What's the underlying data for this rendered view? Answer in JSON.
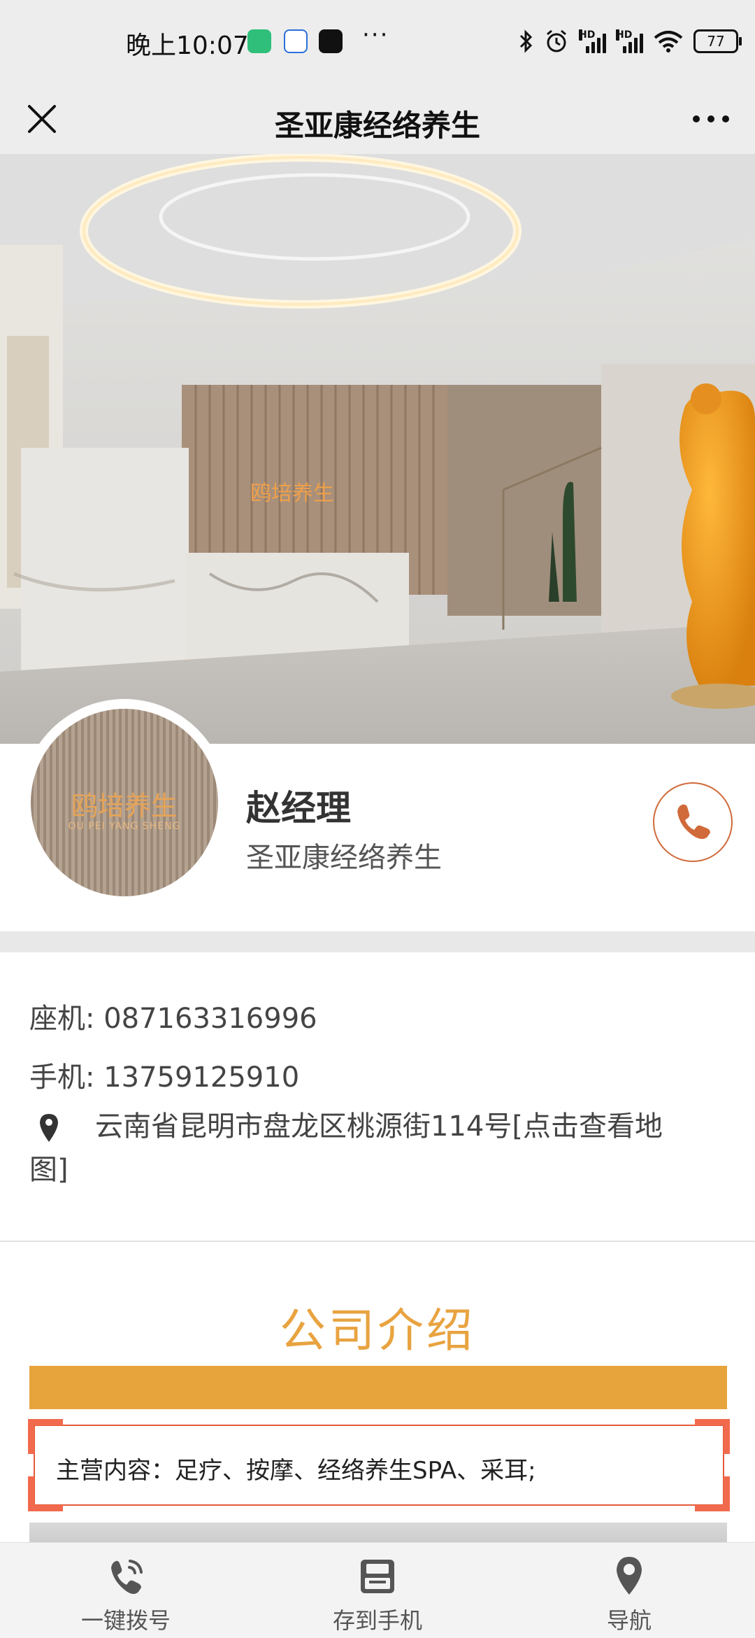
{
  "status_bar": {
    "time": "晚上10:07",
    "more": "···",
    "battery": "77"
  },
  "nav": {
    "title": "圣亚康经络养生"
  },
  "hero": {
    "sign_text": "鸥培养生"
  },
  "profile": {
    "avatar_text": "鸥培养生",
    "avatar_subtext": "OU PEI YANG SHENG",
    "name": "赵经理",
    "company": "圣亚康经络养生"
  },
  "contact": {
    "landline_label": "座机:",
    "landline": "087163316996",
    "mobile_label": "手机:",
    "mobile": "13759125910",
    "address": "云南省昆明市盘龙区桃源街114号[点击查看地图]"
  },
  "intro": {
    "title": "公司介绍",
    "main_business": "主营内容：足疗、按摩、经络养生SPA、采耳;"
  },
  "bottom_bar": [
    {
      "label": "一键拨号",
      "icon": "phone-icon"
    },
    {
      "label": "存到手机",
      "icon": "save-icon"
    },
    {
      "label": "导航",
      "icon": "location-pin-icon"
    }
  ],
  "colors": {
    "accent_orange": "#e8a43c",
    "title_orange": "#e8a340",
    "call_red": "#d06a3a",
    "frame_red": "#e55a3a"
  }
}
